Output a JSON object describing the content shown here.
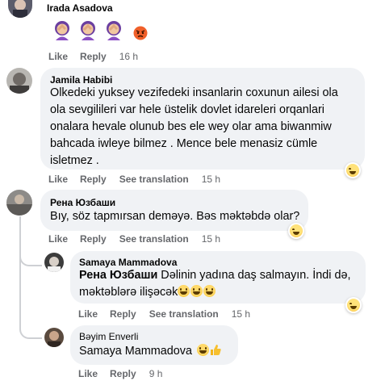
{
  "comments": [
    {
      "author": "Irada Asadova",
      "stickers": [
        "facepalm-woman",
        "facepalm-woman",
        "facepalm-woman",
        "angry-face"
      ],
      "actions": {
        "like": "Like",
        "reply": "Reply",
        "time": "16 h"
      }
    },
    {
      "author": "Jamila Habibi",
      "text_lines": [
        "Olkedeki yuksey vezifedeki insanlarin coxunun ailesi ola",
        "ola sevgilileri var hele üstelik dovlet idareleri orqanlari",
        "onalara hevale olunub bes ele wey olar ama biwanmiw",
        "bahcada iwleye bilmez . Mence bele menasiz cümle",
        "isletmez ."
      ],
      "reaction": "haha",
      "actions": {
        "like": "Like",
        "reply": "Reply",
        "translate": "See translation",
        "time": "15 h"
      }
    },
    {
      "author": "Рена Юзбаши",
      "text_lines": [
        "Bıy, söz tapmırsan deməyə. Bəs məktəbdə olar?"
      ],
      "reaction": "haha",
      "actions": {
        "like": "Like",
        "reply": "Reply",
        "translate": "See translation",
        "time": "15 h"
      }
    },
    {
      "author": "Samaya Mammadova",
      "mention": "Рена Юзбаши",
      "text_line1": " Dəlinin yadına daş salmayın. İndi də,",
      "text_line2": "məktəblərə ilişəcək",
      "reaction": "haha",
      "actions": {
        "like": "Like",
        "reply": "Reply",
        "translate": "See translation",
        "time": "15 h"
      }
    },
    {
      "author": "Bəyim Enverli",
      "mention": "Samaya Mammadova",
      "actions": {
        "like": "Like",
        "reply": "Reply",
        "time": "9 h"
      }
    }
  ]
}
